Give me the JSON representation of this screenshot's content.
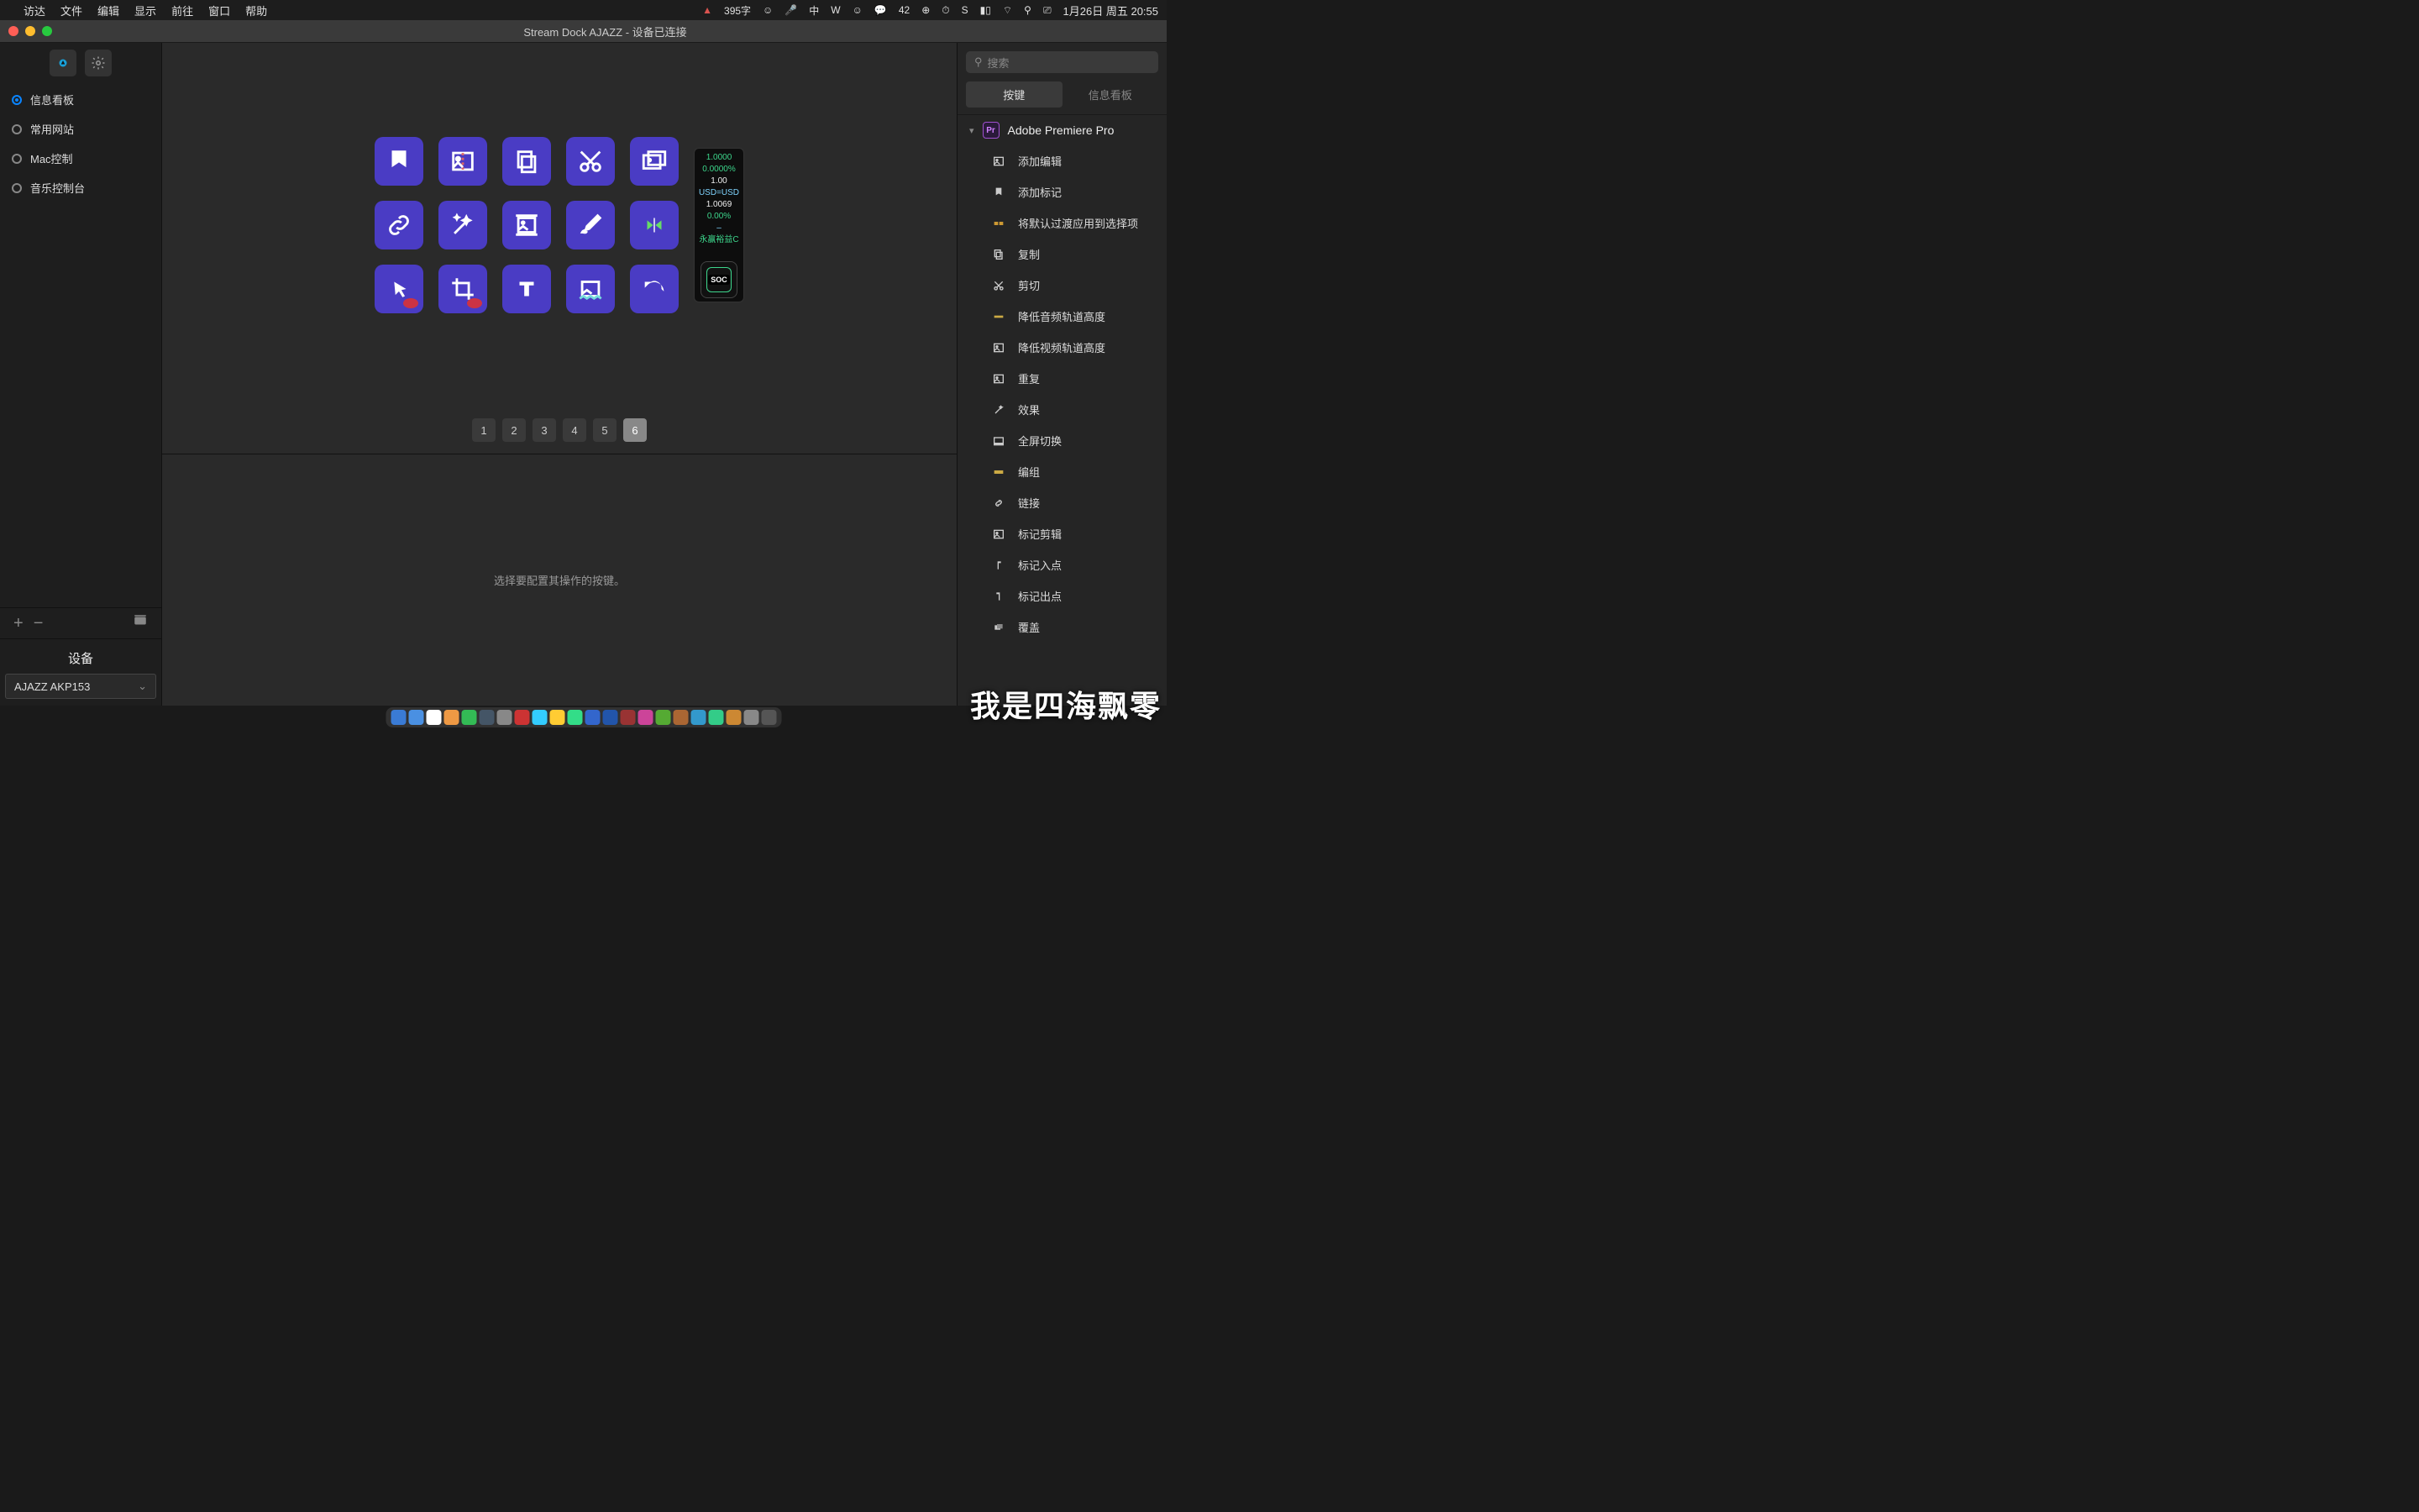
{
  "menubar": {
    "app": "访达",
    "items": [
      "文件",
      "编辑",
      "显示",
      "前往",
      "窗口",
      "帮助"
    ],
    "right": {
      "word_count": "395字",
      "badge": "42",
      "datetime": "1月26日 周五  20:55"
    }
  },
  "window": {
    "title": "Stream Dock AJAZZ - 设备已连接"
  },
  "sidebar_left": {
    "items": [
      {
        "label": "信息看板",
        "selected": true
      },
      {
        "label": "常用网站",
        "selected": false
      },
      {
        "label": "Mac控制",
        "selected": false
      },
      {
        "label": "音乐控制台",
        "selected": false
      }
    ],
    "device_header": "设备",
    "device_value": "AJAZZ AKP153"
  },
  "center": {
    "keys": [
      {
        "icon": "add-marker"
      },
      {
        "icon": "add-edit"
      },
      {
        "icon": "copy"
      },
      {
        "icon": "cut"
      },
      {
        "icon": "mark-clip"
      },
      {
        "icon": "link"
      },
      {
        "icon": "effects"
      },
      {
        "icon": "lower-video"
      },
      {
        "icon": "brush"
      },
      {
        "icon": "in-out"
      },
      {
        "icon": "select",
        "eye": true
      },
      {
        "icon": "crop",
        "eye": true
      },
      {
        "icon": "text"
      },
      {
        "icon": "lower-audio"
      },
      {
        "icon": "undo"
      }
    ],
    "knob": {
      "lines": [
        {
          "text": "1.0000",
          "cls": "g"
        },
        {
          "text": "0.0000%",
          "cls": "g"
        },
        {
          "text": "1.00",
          "cls": "w"
        },
        {
          "text": "USD=USD",
          "cls": "b"
        },
        {
          "text": "1.0069",
          "cls": "w"
        },
        {
          "text": "0.00%",
          "cls": "g"
        },
        {
          "text": "–",
          "cls": "b"
        },
        {
          "text": "永赢裕益C",
          "cls": "g"
        }
      ],
      "chip": "SOC"
    },
    "pages": [
      "1",
      "2",
      "3",
      "4",
      "5",
      "6"
    ],
    "active_page": 6,
    "detail_placeholder": "选择要配置其操作的按键。"
  },
  "sidebar_right": {
    "search_placeholder": "搜索",
    "tabs": [
      "按键",
      "信息看板"
    ],
    "active_tab": 0,
    "group": "Adobe Premiere Pro",
    "actions": [
      {
        "label": "添加编辑",
        "icon": "image"
      },
      {
        "label": "添加标记",
        "icon": "marker"
      },
      {
        "label": "将默认过渡应用到选择项",
        "icon": "transition"
      },
      {
        "label": "复制",
        "icon": "copy"
      },
      {
        "label": "剪切",
        "icon": "cut"
      },
      {
        "label": "降低音频轨道高度",
        "icon": "audio-track"
      },
      {
        "label": "降低视频轨道高度",
        "icon": "image"
      },
      {
        "label": "重复",
        "icon": "image"
      },
      {
        "label": "效果",
        "icon": "wand"
      },
      {
        "label": "全屏切换",
        "icon": "fullscreen"
      },
      {
        "label": "编组",
        "icon": "group"
      },
      {
        "label": "链接",
        "icon": "link"
      },
      {
        "label": "标记剪辑",
        "icon": "image"
      },
      {
        "label": "标记入点",
        "icon": "in-point"
      },
      {
        "label": "标记出点",
        "icon": "out-point"
      },
      {
        "label": "覆盖",
        "icon": "overlay"
      }
    ]
  },
  "watermark": "我是四海飘零"
}
